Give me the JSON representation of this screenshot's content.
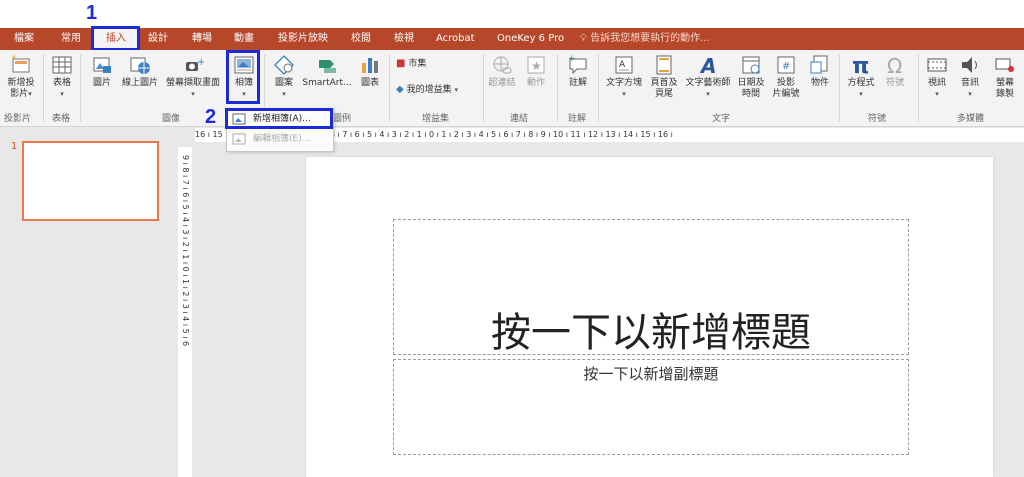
{
  "annotations": {
    "step1": "1",
    "step2": "2",
    "highlight_color": "#1c2bd8"
  },
  "tabs": [
    {
      "label": "檔案"
    },
    {
      "label": "常用"
    },
    {
      "label": "插入"
    },
    {
      "label": "設計"
    },
    {
      "label": "轉場"
    },
    {
      "label": "動畫"
    },
    {
      "label": "投影片放映"
    },
    {
      "label": "校閱"
    },
    {
      "label": "檢視"
    },
    {
      "label": "Acrobat"
    },
    {
      "label": "OneKey 6 Pro"
    }
  ],
  "active_tab": "插入",
  "tell_me": "告訴我您想要執行的動作...",
  "ribbon": {
    "new_slide_1": "新增投",
    "new_slide_2": "影片",
    "table": "表格",
    "picture": "圖片",
    "online_picture": "線上圖片",
    "screenshot": "螢幕擷取畫面",
    "album": "相簿",
    "shapes": "圖案",
    "smartart": "SmartArt...",
    "chart": "圖表",
    "store": "市集",
    "my_addins": "我的增益集",
    "hyperlink": "超連結",
    "action": "動作",
    "comment": "註解",
    "textbox": "文字方塊",
    "header_footer_1": "頁首及",
    "header_footer_2": "頁尾",
    "wordart": "文字藝術師",
    "datetime_1": "日期及",
    "datetime_2": "時間",
    "slide_number_1": "投影",
    "slide_number_2": "片編號",
    "object": "物件",
    "equation": "方程式",
    "symbol": "符號",
    "video": "視訊",
    "audio": "音訊",
    "screen_record_1": "螢幕",
    "screen_record_2": "錄製"
  },
  "groups": {
    "slides": "投影片",
    "tables": "表格",
    "images": "圖像",
    "illustrations": "圖例",
    "addins": "增益集",
    "links": "連結",
    "comments": "註解",
    "text": "文字",
    "symbols": "符號",
    "media": "多媒體"
  },
  "dropdown": {
    "new_album": "新增相簿(A)...",
    "edit_album": "編輯相簿(E)..."
  },
  "ruler_text": "16 ı 15 ı 14 ı 13 ı 12 ı 11 ı 10 ı 9 ı 8 ı 7 ı 6 ı 5 ı 4 ı 3 ı 2 ı 1 ı 0 ı 1 ı 2 ı 3 ı 4 ı 5 ı 6 ı 7 ı 8 ı 9 ı 10 ı 11 ı 12 ı 13 ı 14 ı 15 ı 16 ı",
  "vruler_text": "9 ı 8 ı 7 ı 6 ı 5 ı 4 ı 3 ı 2 ı 1 ı 0 ı 1 ı 2 ı 3 ı 4 ı 5 ı 6",
  "slide": {
    "number": "1",
    "title_placeholder": "按一下以新增標題",
    "subtitle_placeholder": "按一下以新增副標題"
  },
  "colors": {
    "accent": "#b7472a",
    "thumb_border": "#e87b4e"
  }
}
